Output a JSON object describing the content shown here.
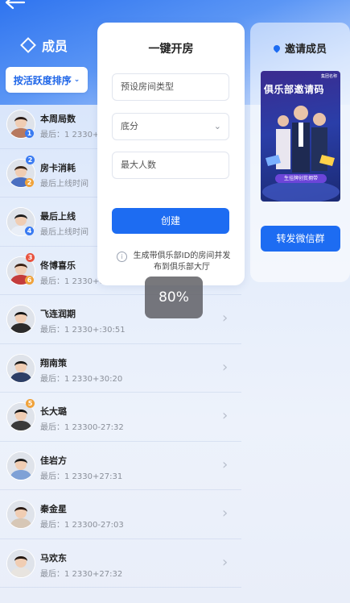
{
  "header": {
    "back_icon": "arrow-left-icon",
    "members_title": "成员"
  },
  "sort": {
    "label": "按活跃度排序"
  },
  "members": [
    {
      "name": "本周局数",
      "sub": "最后：1 2330+0",
      "badge": "1",
      "badge_color": "#3a7bf2",
      "hair": "#2a1c16",
      "shirt": "#b7795f"
    },
    {
      "name": "房卡消耗",
      "sub": "最后上线时间",
      "badge": "2",
      "badge_color": "#f0a23a",
      "top_badge": "2",
      "hair": "#3a2618",
      "shirt": "#4b6fc1"
    },
    {
      "name": "最后上线",
      "sub": "最后上线时间",
      "badge": "4",
      "badge_color": "#3a7bf2",
      "hair": "#1d1d1d",
      "shirt": "#e9eef7"
    },
    {
      "name": "佟博喜乐",
      "sub": "最后：1 2330+0",
      "badge": "6",
      "badge_color": "#f0a23a",
      "top_badge": "3",
      "hair": "#3b2114",
      "shirt": "#c43c3c"
    },
    {
      "name": "飞连润期",
      "sub": "最后：1 2330+:30:51",
      "hair": "#141414",
      "shirt": "#2b2b2b"
    },
    {
      "name": "翔南策",
      "sub": "最后：1 2330+30:20",
      "hair": "#1b1b1b",
      "shirt": "#2c3e66"
    },
    {
      "name": "长大璐",
      "sub": "最后：1 23300-27:32",
      "top_badge": "5",
      "hair": "#121212",
      "shirt": "#3a3a3a"
    },
    {
      "name": "佳岩方",
      "sub": "最后：1 2330+27:31",
      "hair": "#1a1a1a",
      "shirt": "#7fa1d6"
    },
    {
      "name": "秦金星",
      "sub": "最后：1 23300-27:03",
      "hair": "#2a1a12",
      "shirt": "#d7c7b6"
    },
    {
      "name": "马欢东",
      "sub": "最后：1 2330+27:32",
      "hair": "#22160f",
      "shirt": "#e8e4df"
    }
  ],
  "create_card": {
    "title": "一键开房",
    "room_type_placeholder": "预设房间类型",
    "base_score_label": "底分",
    "max_players_placeholder": "最大人数",
    "create_label": "创建",
    "note": "生成带俱乐部ID的房间并发布到俱乐部大厅"
  },
  "invite_card": {
    "title": "邀请成员",
    "poster_title": "俱乐部邀请码",
    "poster_brand": "集团名称",
    "poster_tag": "生挂牌创贫拥带",
    "share_label": "转发微信群"
  },
  "toast": {
    "text": "80%"
  },
  "colors": {
    "accent": "#1d6cf2",
    "header": "#2f74ef"
  }
}
